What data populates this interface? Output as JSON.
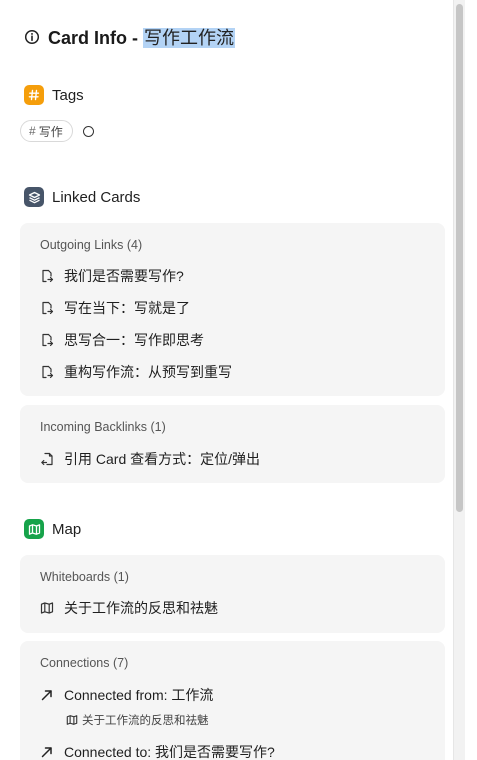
{
  "header": {
    "title_prefix": "Card Info - ",
    "title_highlight": "写作工作流"
  },
  "tags_section": {
    "label": "Tags",
    "tags": [
      "写作"
    ],
    "hash": "#",
    "accent": "#f59e0b"
  },
  "linked_section": {
    "label": "Linked Cards",
    "accent": "#475569",
    "outgoing": {
      "title": "Outgoing Links (4)",
      "items": [
        "我们是否需要写作?",
        "写在当下：写就是了",
        "思写合一：写作即思考",
        "重构写作流：从预写到重写"
      ]
    },
    "incoming": {
      "title": "Incoming Backlinks (1)",
      "items": [
        "引用 Card 查看方式：定位/弹出"
      ]
    }
  },
  "map_section": {
    "label": "Map",
    "accent": "#16a34a",
    "whiteboards": {
      "title": "Whiteboards (1)",
      "items": [
        "关于工作流的反思和祛魅"
      ]
    },
    "connections": {
      "title": "Connections (7)",
      "items": [
        {
          "label": "Connected from: 工作流",
          "sub": "关于工作流的反思和祛魅"
        },
        {
          "label": "Connected to: 我们是否需要写作?"
        }
      ]
    }
  }
}
